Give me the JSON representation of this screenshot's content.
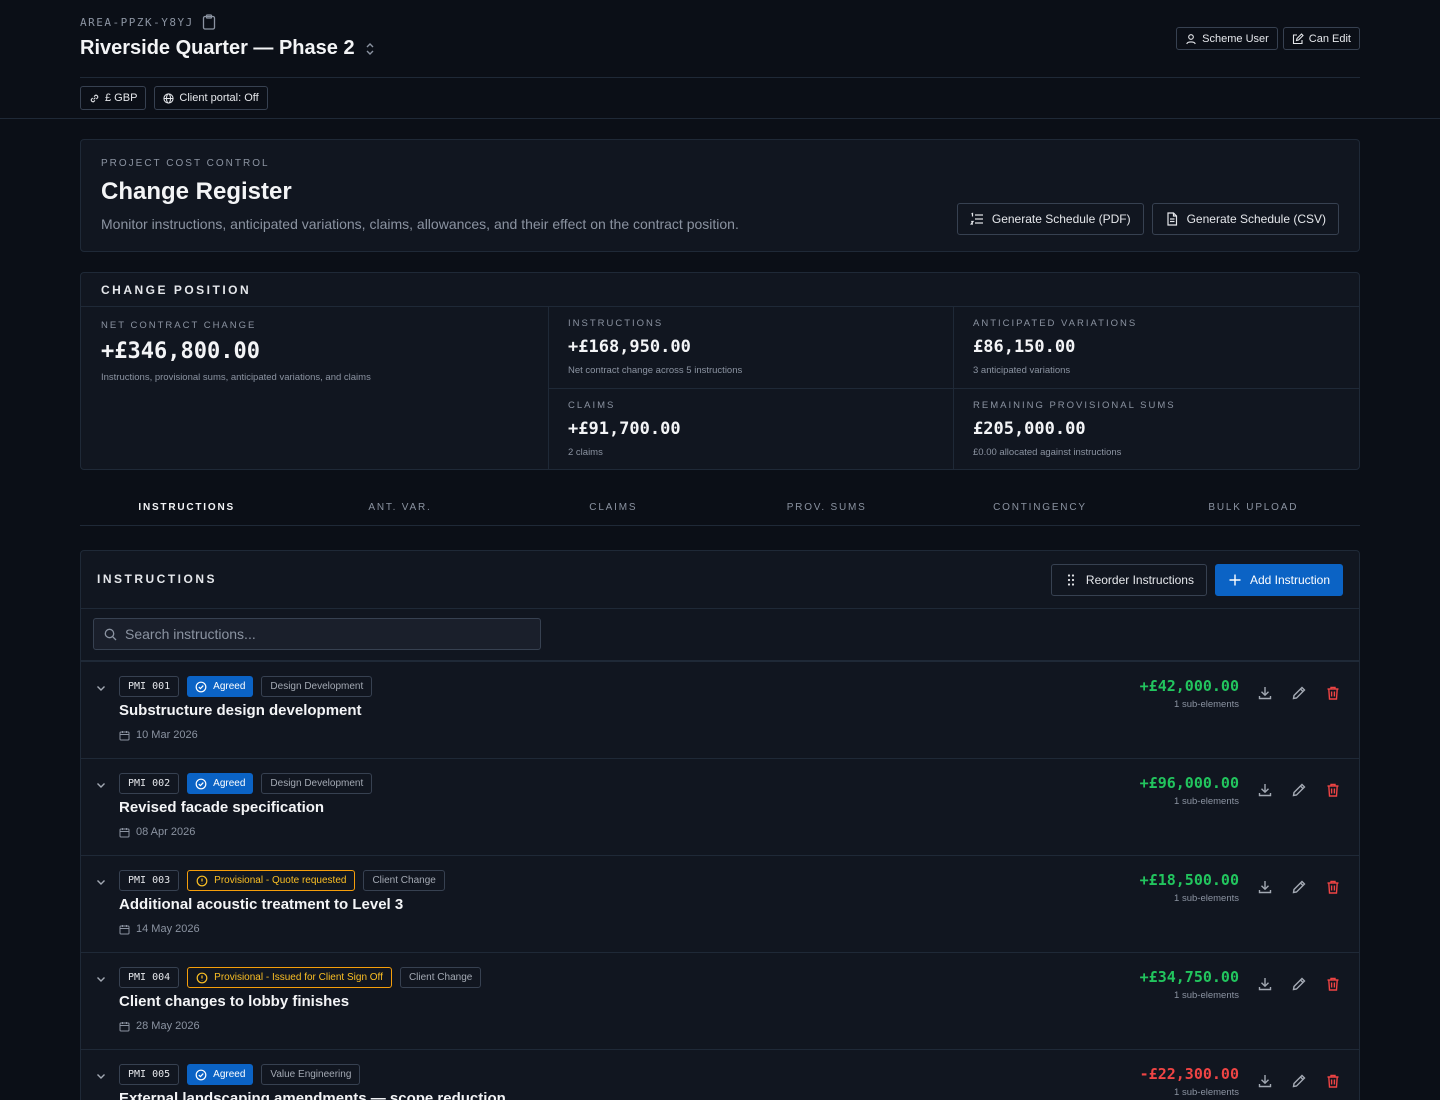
{
  "header": {
    "area_id": "AREA-PPZK-Y8YJ",
    "project_title": "Riverside Quarter — Phase 2",
    "scheme_user_label": "Scheme User",
    "can_edit_label": "Can Edit",
    "currency_chip": "£ GBP",
    "portal_chip": "Client portal: Off"
  },
  "hero": {
    "eyebrow": "PROJECT COST CONTROL",
    "title": "Change Register",
    "description": "Monitor instructions, anticipated variations, claims, allowances, and their effect on the contract position.",
    "pdf_button": "Generate Schedule (PDF)",
    "csv_button": "Generate Schedule (CSV)"
  },
  "position": {
    "title": "CHANGE POSITION",
    "net": {
      "label": "NET CONTRACT CHANGE",
      "value": "+£346,800.00",
      "note": "Instructions, provisional sums, anticipated variations, and claims"
    },
    "instructions": {
      "label": "INSTRUCTIONS",
      "value": "+£168,950.00",
      "note": "Net contract change across 5 instructions"
    },
    "anticipated": {
      "label": "ANTICIPATED VARIATIONS",
      "value": "£86,150.00",
      "note": "3 anticipated variations"
    },
    "claims": {
      "label": "CLAIMS",
      "value": "+£91,700.00",
      "note": "2 claims"
    },
    "provisional": {
      "label": "REMAINING PROVISIONAL SUMS",
      "value": "£205,000.00",
      "note": "£0.00 allocated against instructions"
    }
  },
  "tabs": [
    "INSTRUCTIONS",
    "ANT. VAR.",
    "CLAIMS",
    "PROV. SUMS",
    "CONTINGENCY",
    "BULK UPLOAD"
  ],
  "instructions_panel": {
    "title": "INSTRUCTIONS",
    "reorder_button": "Reorder Instructions",
    "add_button": "Add Instruction",
    "search_placeholder": "Search instructions..."
  },
  "rows": [
    {
      "code": "PMI 001",
      "status": "Agreed",
      "status_kind": "agreed",
      "category": "Design Development",
      "title": "Substructure design development",
      "date": "10 Mar 2026",
      "amount": "+£42,000.00",
      "amount_sign": "pos",
      "sub": "1 sub-elements"
    },
    {
      "code": "PMI 002",
      "status": "Agreed",
      "status_kind": "agreed",
      "category": "Design Development",
      "title": "Revised facade specification",
      "date": "08 Apr 2026",
      "amount": "+£96,000.00",
      "amount_sign": "pos",
      "sub": "1 sub-elements"
    },
    {
      "code": "PMI 003",
      "status": "Provisional - Quote requested",
      "status_kind": "prov",
      "category": "Client Change",
      "title": "Additional acoustic treatment to Level 3",
      "date": "14 May 2026",
      "amount": "+£18,500.00",
      "amount_sign": "pos",
      "sub": "1 sub-elements"
    },
    {
      "code": "PMI 004",
      "status": "Provisional - Issued for Client Sign Off",
      "status_kind": "prov",
      "category": "Client Change",
      "title": "Client changes to lobby finishes",
      "date": "28 May 2026",
      "amount": "+£34,750.00",
      "amount_sign": "pos",
      "sub": "1 sub-elements"
    },
    {
      "code": "PMI 005",
      "status": "Agreed",
      "status_kind": "agreed",
      "category": "Value Engineering",
      "title": "External landscaping amendments — scope reduction",
      "date": "",
      "amount": "-£22,300.00",
      "amount_sign": "neg",
      "sub": "1 sub-elements"
    }
  ],
  "colors": {
    "background": "#0b0f17",
    "card": "#111620",
    "primary": "#0b63c5",
    "positive": "#22c55e",
    "negative": "#ef4444",
    "provisional": "#f59e0b",
    "delete": "#ef4444"
  }
}
